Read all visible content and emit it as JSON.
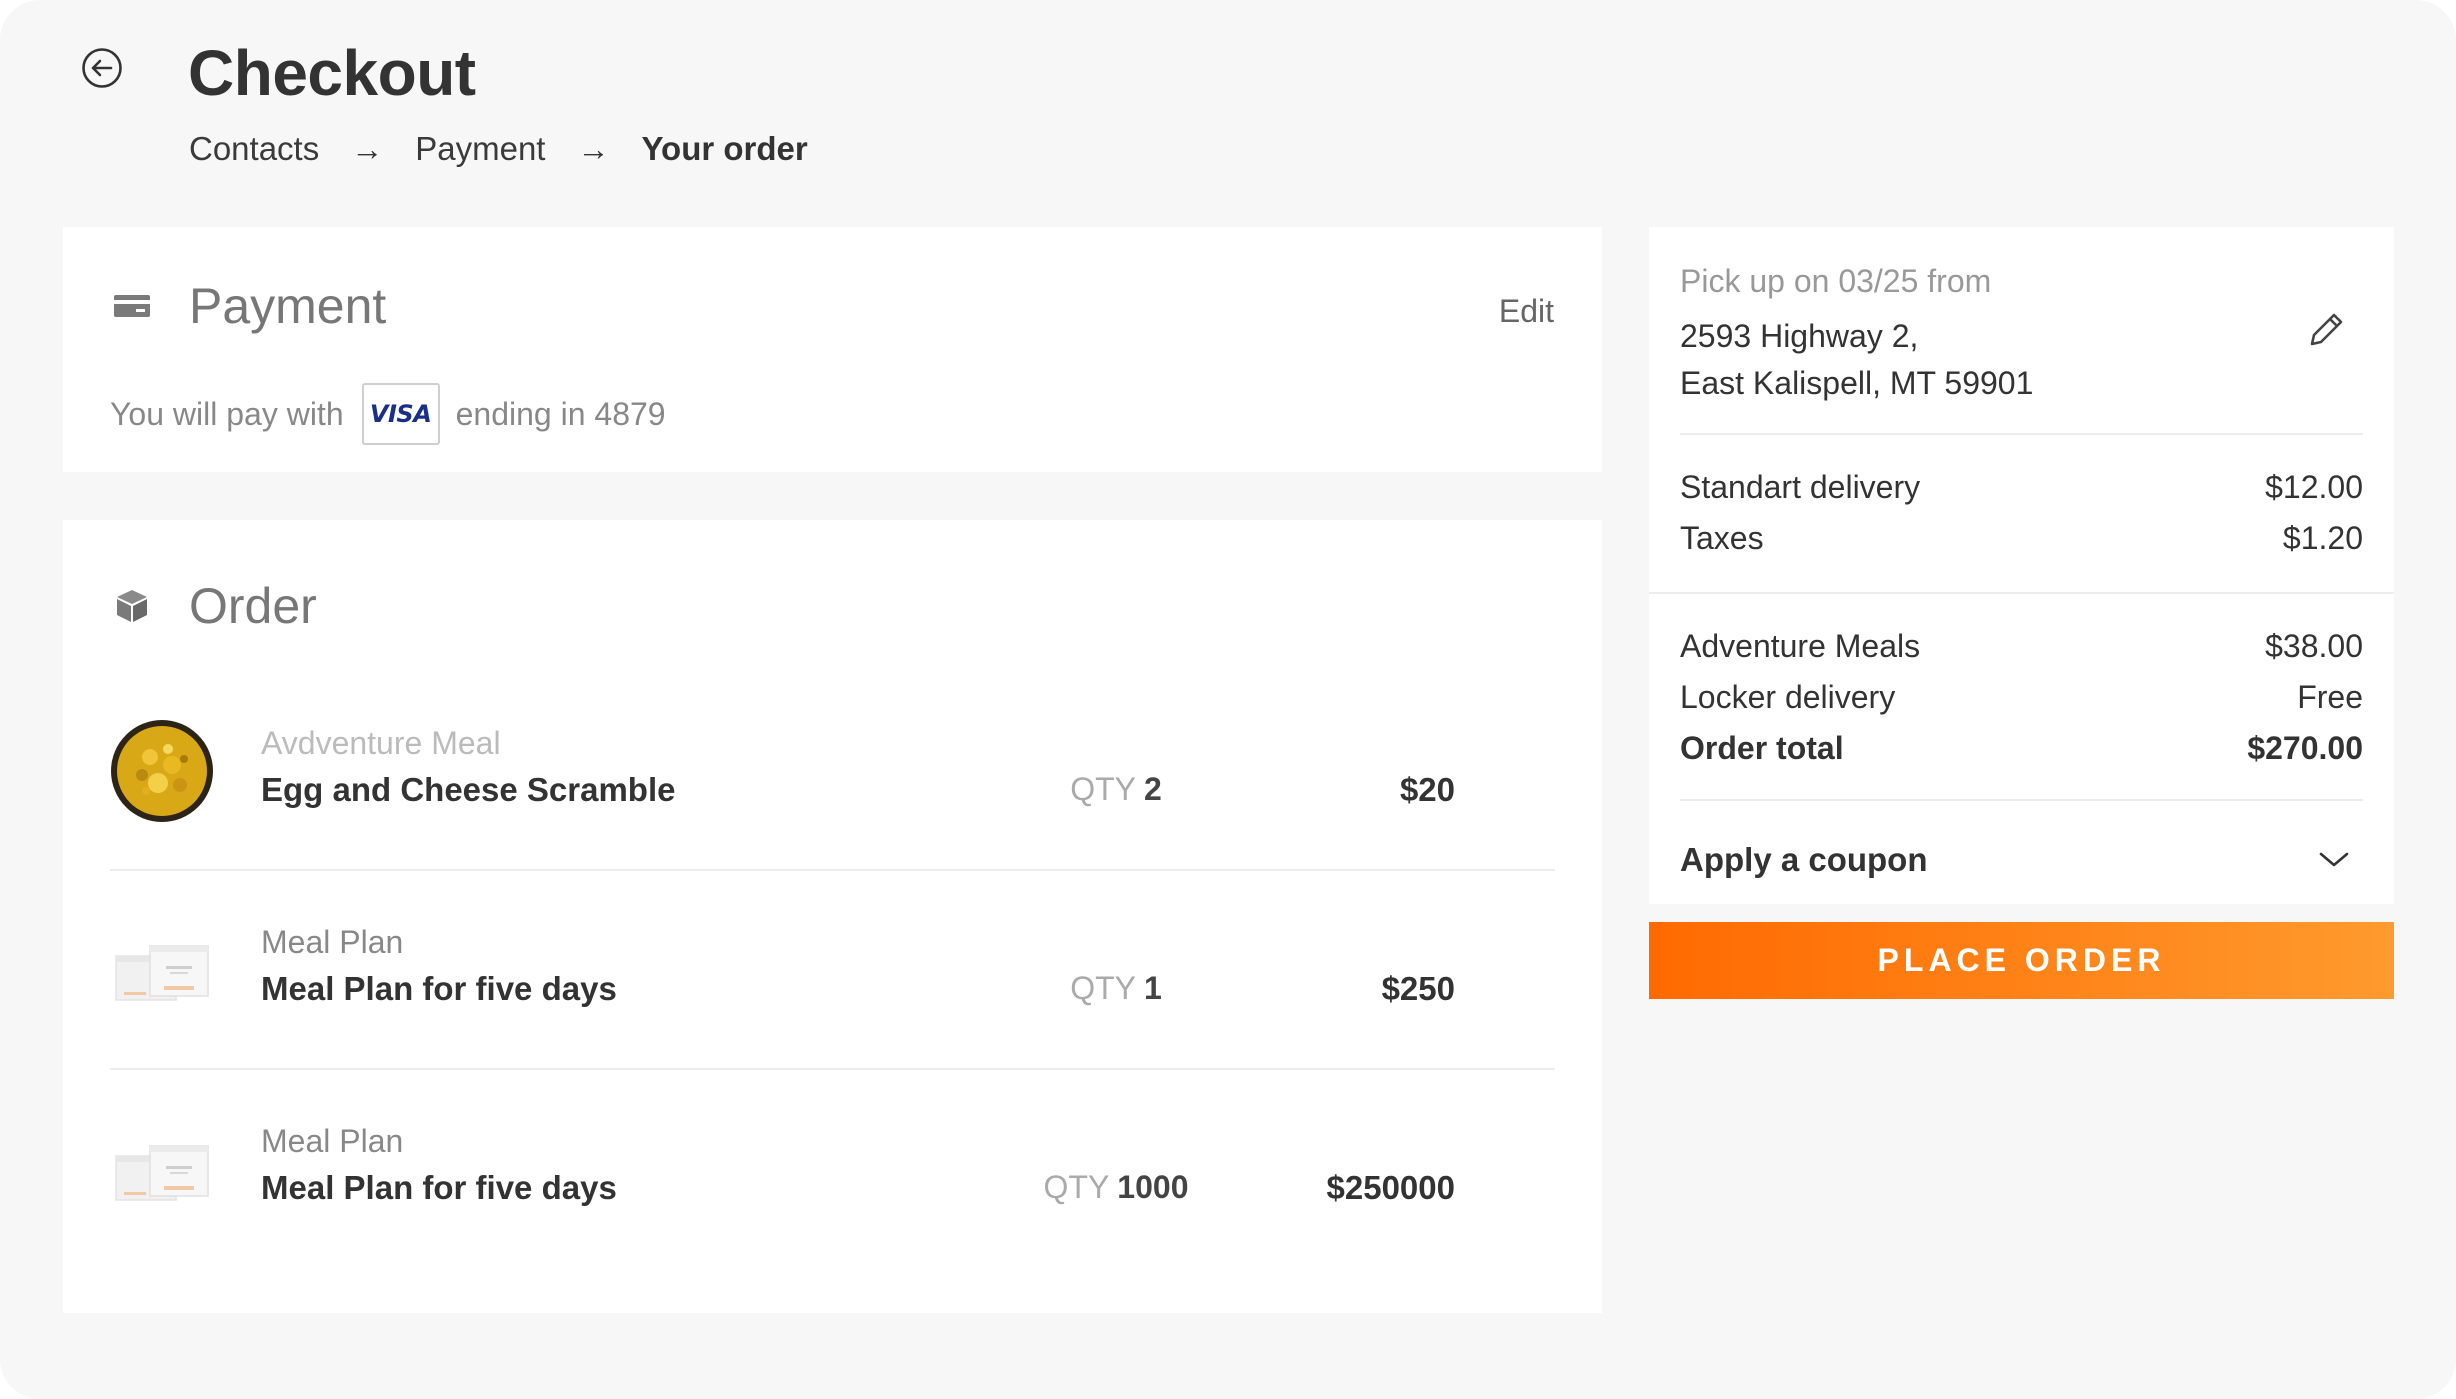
{
  "header": {
    "title": "Checkout",
    "breadcrumb": [
      "Contacts",
      "Payment",
      "Your order"
    ],
    "separator": "→"
  },
  "payment": {
    "title": "Payment",
    "edit_label": "Edit",
    "pay_prefix": "You will pay with",
    "card_brand": "VISA",
    "card_suffix": "ending in 4879"
  },
  "order": {
    "title": "Order",
    "qty_label": "QTY",
    "items": [
      {
        "category": "Avdventure Meal",
        "name": "Egg and Cheese Scramble",
        "qty": "2",
        "price": "$20",
        "thumb": "scramble-plate-icon"
      },
      {
        "category": "Meal Plan",
        "name": "Meal Plan for five days",
        "qty": "1",
        "price": "$250",
        "thumb": "meal-box-icon"
      },
      {
        "category": "Meal Plan",
        "name": "Meal Plan for five days",
        "qty": "1000",
        "price": "$250000",
        "thumb": "meal-box-icon"
      }
    ]
  },
  "summary": {
    "pickup_label": "Pick up on 03/25 from",
    "address_line1": "2593 Highway 2,",
    "address_line2": "East Kalispell, MT 59901",
    "delivery_label": "Standart delivery",
    "delivery_value": "$12.00",
    "taxes_label": "Taxes",
    "taxes_value": "$1.20",
    "meals_label": "Adventure Meals",
    "meals_value": "$38.00",
    "locker_label": "Locker delivery",
    "locker_value": "Free",
    "total_label": "Order total",
    "total_value": "$270.00",
    "coupon_label": "Apply a coupon"
  },
  "actions": {
    "place_order": "PLACE ORDER"
  },
  "colors": {
    "accent_start": "#ff6a00",
    "accent_end": "#ff9a2e",
    "visa_blue": "#1a2f8a"
  }
}
